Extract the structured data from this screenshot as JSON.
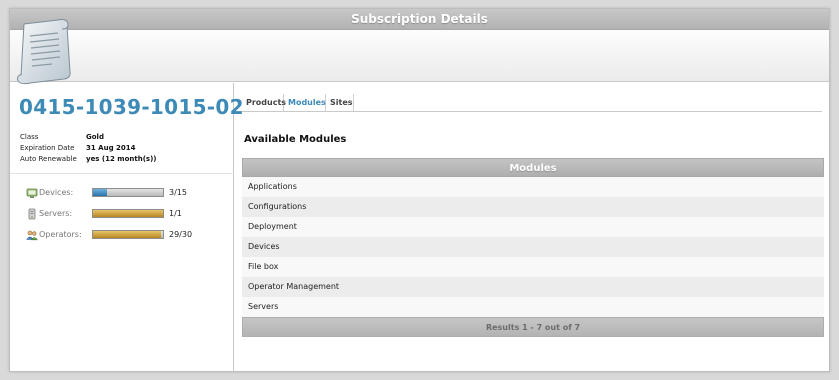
{
  "window": {
    "title": "Subscription Details"
  },
  "subscription": {
    "id": "0415-1039-1015-02",
    "info": [
      {
        "key": "Class",
        "value": "Gold"
      },
      {
        "key": "Expiration Date",
        "value": "31 Aug 2014"
      },
      {
        "key": "Auto Renewable",
        "value": "yes (12 month(s))"
      }
    ]
  },
  "usage": [
    {
      "label": "Devices:",
      "icon": "devices-icon",
      "count": "3/15",
      "fraction": 0.2,
      "color": "#2a73ac"
    },
    {
      "label": "Servers:",
      "icon": "servers-icon",
      "count": "1/1",
      "fraction": 1.0,
      "color": "#b68722"
    },
    {
      "label": "Operators:",
      "icon": "operators-icon",
      "count": "29/30",
      "fraction": 0.967,
      "color": "#b68722"
    }
  ],
  "tabs": [
    {
      "label": "Products",
      "active": false
    },
    {
      "label": "Modules",
      "active": true
    },
    {
      "label": "Sites",
      "active": false
    }
  ],
  "section_title": "Available Modules",
  "modules_table": {
    "header": "Modules",
    "rows": [
      "Applications",
      "Configurations",
      "Deployment",
      "Devices",
      "File box",
      "Operator Management",
      "Servers"
    ],
    "footer": "Results 1 - 7 out of 7"
  },
  "colors": {
    "accent": "#3d8ab7",
    "bar_blue": "#2a73ac",
    "bar_gold": "#b68722"
  }
}
